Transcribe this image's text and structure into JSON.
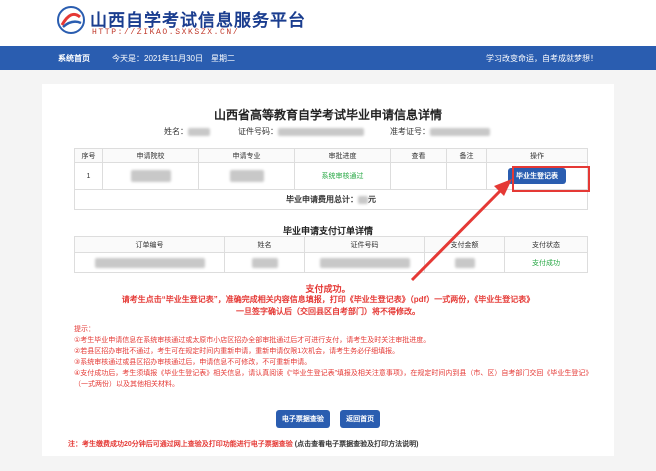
{
  "header": {
    "site_title": "山西自学考试信息服务平台",
    "site_url": "HTTP://ZIKAO.SXKSZX.CN/"
  },
  "nav": {
    "home": "系统首页",
    "date": "今天是：2021年11月30日　星期二",
    "slogan": "学习改变命运，自考成就梦想！"
  },
  "page": {
    "title": "山西省高等教育自学考试毕业申请信息详情",
    "name_label": "姓名：",
    "id_label": "证件号码：",
    "exam_no_label": "准考证号："
  },
  "apply_table": {
    "headers": [
      "序号",
      "申请院校",
      "申请专业",
      "审批进度",
      "查看",
      "备注",
      "操作"
    ],
    "row": {
      "index": "1",
      "status": "系统审核通过",
      "action_label": "毕业生登记表"
    },
    "total_label": "毕业申请费用总计：",
    "total_unit": "元"
  },
  "order_section": {
    "title": "毕业申请支付订单详情",
    "headers": [
      "订单编号",
      "姓名",
      "证件号码",
      "支付金额",
      "支付状态"
    ],
    "row": {
      "status": "支付成功"
    }
  },
  "notices": {
    "paid": "支付成功。",
    "line1": "请考生点击“毕业生登记表”，准确完成相关内容信息填报，打印《毕业生登记表》（pdf）一式两份，《毕业生登记表》",
    "line2": "一旦签字确认后（交回县区自考部门）将不得修改。"
  },
  "tips": {
    "title": "提示：",
    "items": [
      "①考生毕业申请信息在系统审核通过或太原市小店区招办全部审批通过后才可进行支付，请考生及时关注审批进度。",
      "②若县区招办审批不通过，考生可在规定时间内重新申请，重新申请仅限1次机会，请考生务必仔细填报。",
      "③系统审核通过或县区招办审核通过后，申请信息不可修改，不可重新申请。",
      "④支付成功后，考生须填报《毕业生登记表》相关信息，请认真阅读《“毕业生登记表”填报及相关注意事项》，在规定时间内到县（市、区）自考部门交回《毕业生登记》（一式两份）以及其他相关材料。"
    ]
  },
  "buttons": {
    "invoice": "电子票据查验",
    "back": "返回首页"
  },
  "footer": {
    "note": "注：考生缴费成功20分钟后可通过网上查验及打印功能进行电子票据查验",
    "link": "(点击查看电子票据查验及打印方法说明)"
  },
  "colors": {
    "brand_blue": "#2a5db0",
    "title_blue": "#1a3d8f",
    "alert_red": "#e53935",
    "success_green": "#27a844"
  }
}
